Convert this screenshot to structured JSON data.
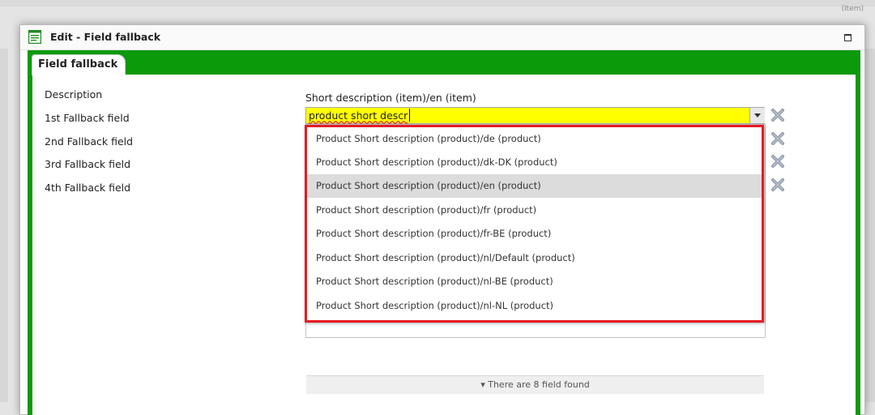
{
  "window": {
    "title": "Edit - Field fallback",
    "corner_text": "(Item)"
  },
  "tab": {
    "label": "Field fallback"
  },
  "form": {
    "labels": [
      "Description",
      "1st Fallback field",
      "2nd Fallback field",
      "3rd Fallback field",
      "4th Fallback field"
    ],
    "description_value": "Short description (item)/en (item)",
    "fallback1": {
      "value": "product short descr"
    }
  },
  "dropdown": {
    "items": [
      "Product Short description (product)/de (product)",
      "Product Short description (product)/dk-DK (product)",
      "Product Short description (product)/en (product)",
      "Product Short description (product)/fr (product)",
      "Product Short description (product)/fr-BE (product)",
      "Product Short description (product)/nl/Default (product)",
      "Product Short description (product)/nl-BE (product)",
      "Product Short description (product)/nl-NL (product)"
    ],
    "highlighted_index": 2,
    "footer": "▾ There are 8 field found"
  },
  "colors": {
    "green_frame": "#0a9a0a",
    "highlight_input": "#ffff00",
    "annotation_red": "#e51b23"
  },
  "icons": {
    "title": "form-icon",
    "maximize": "maximize-icon",
    "remove": "remove-x-icon",
    "dropdown_arrow": "chevron-down-icon"
  }
}
